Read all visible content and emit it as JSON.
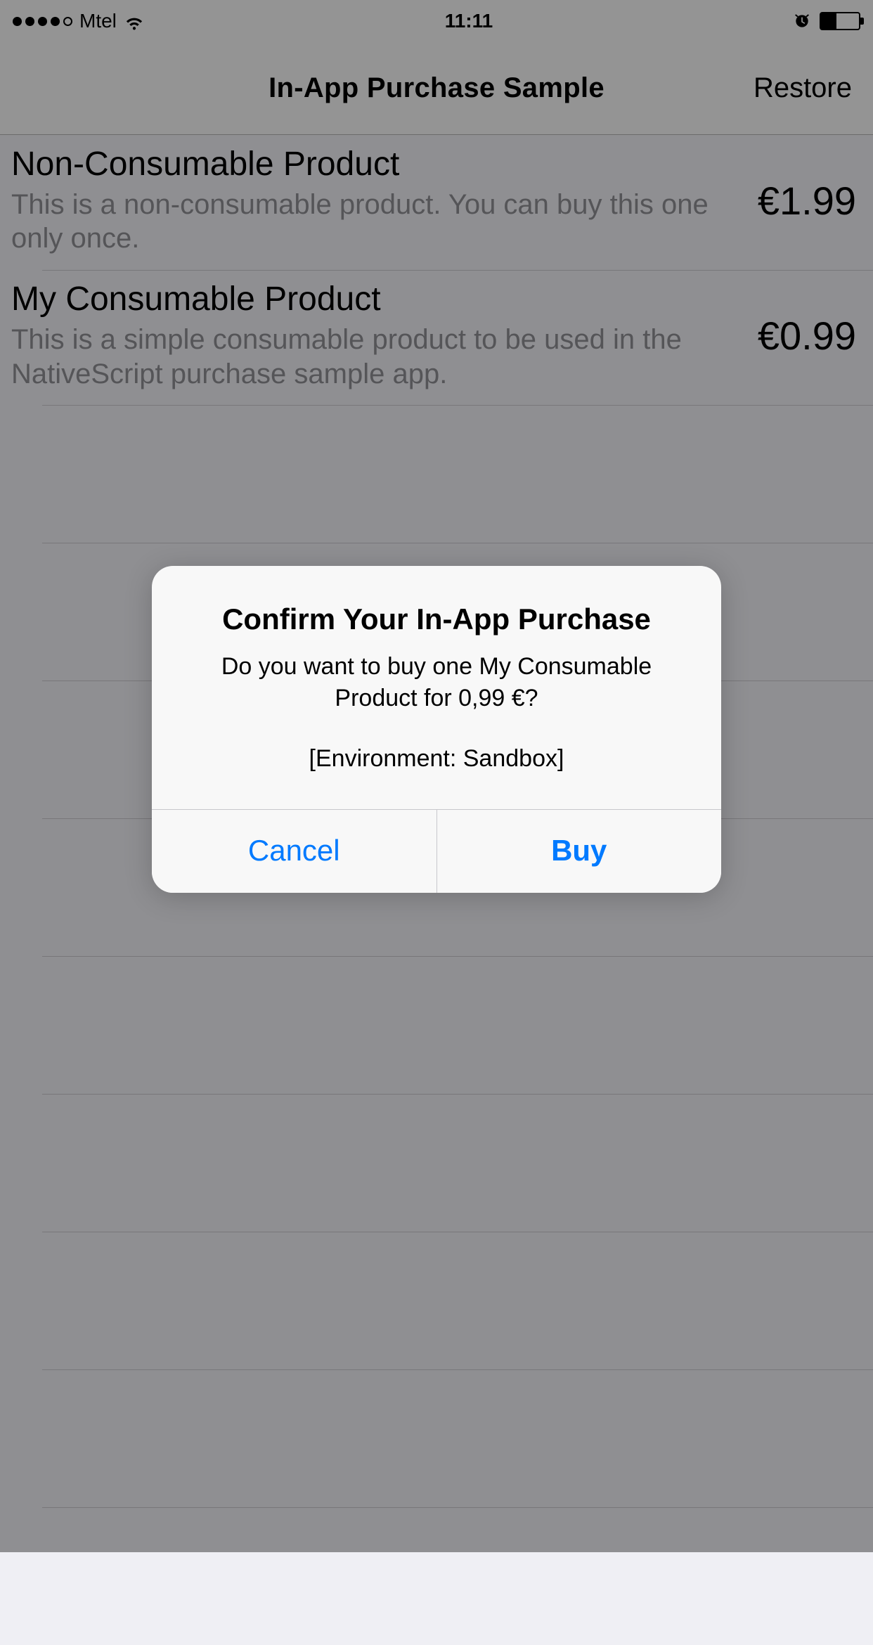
{
  "status_bar": {
    "carrier": "Mtel",
    "time": "11:11"
  },
  "nav": {
    "title": "In-App Purchase Sample",
    "right": "Restore"
  },
  "products": [
    {
      "title": "Non-Consumable Product",
      "desc": "This is a non-consumable product. You can buy this one only once.",
      "price": "€1.99"
    },
    {
      "title": "My Consumable Product",
      "desc": "This is a simple consumable product to be used in the NativeScript purchase sample app.",
      "price": "€0.99"
    }
  ],
  "alert": {
    "title": "Confirm Your In-App Purchase",
    "message": "Do you want to buy one My Consumable Product for 0,99 €?",
    "environment": "[Environment: Sandbox]",
    "cancel": "Cancel",
    "buy": "Buy"
  }
}
